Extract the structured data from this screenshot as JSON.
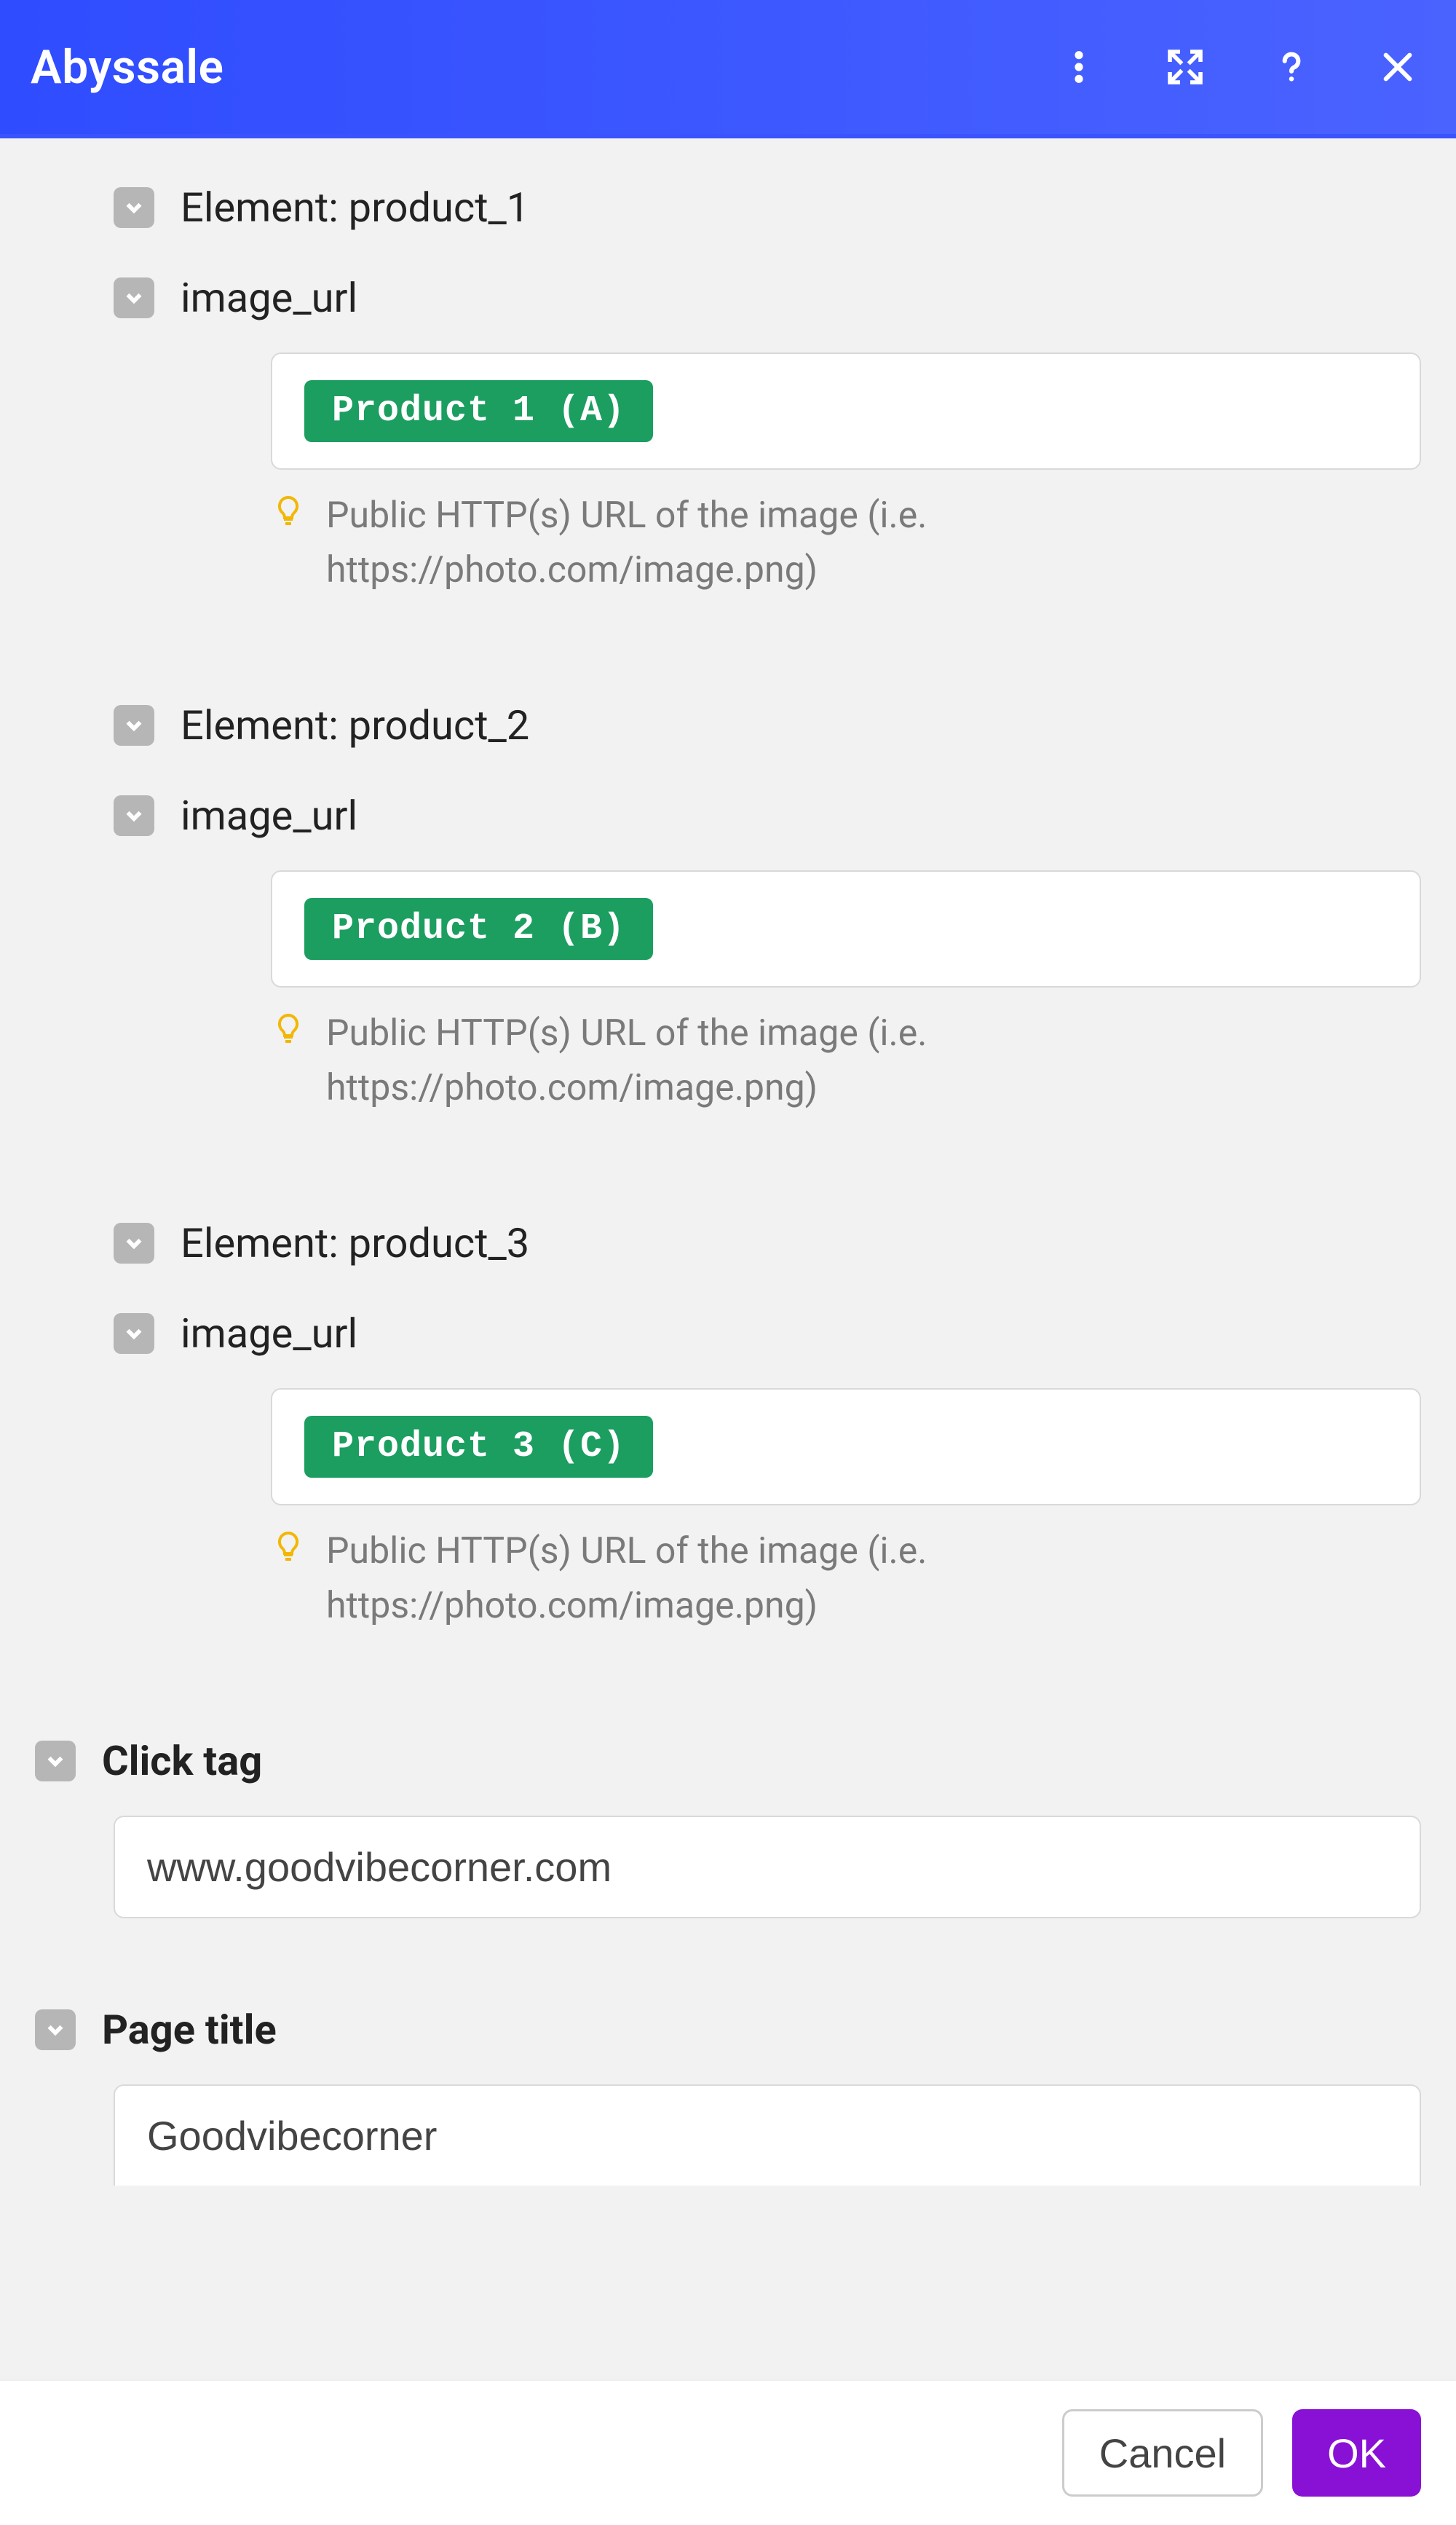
{
  "header": {
    "title": "Abyssale"
  },
  "elements": [
    {
      "label": "Element: product_1",
      "param": "image_url",
      "pill": "Product 1 (A)",
      "hint": "Public HTTP(s) URL of the image (i.e. https://photo.com/image.png)"
    },
    {
      "label": "Element: product_2",
      "param": "image_url",
      "pill": "Product 2 (B)",
      "hint": "Public HTTP(s) URL of the image (i.e. https://photo.com/image.png)"
    },
    {
      "label": "Element: product_3",
      "param": "image_url",
      "pill": "Product 3 (C)",
      "hint": "Public HTTP(s) URL of the image (i.e. https://photo.com/image.png)"
    }
  ],
  "click_tag": {
    "label": "Click tag",
    "value": "www.goodvibecorner.com"
  },
  "page_title": {
    "label": "Page title",
    "value": "Goodvibecorner"
  },
  "footer": {
    "cancel": "Cancel",
    "ok": "OK"
  }
}
